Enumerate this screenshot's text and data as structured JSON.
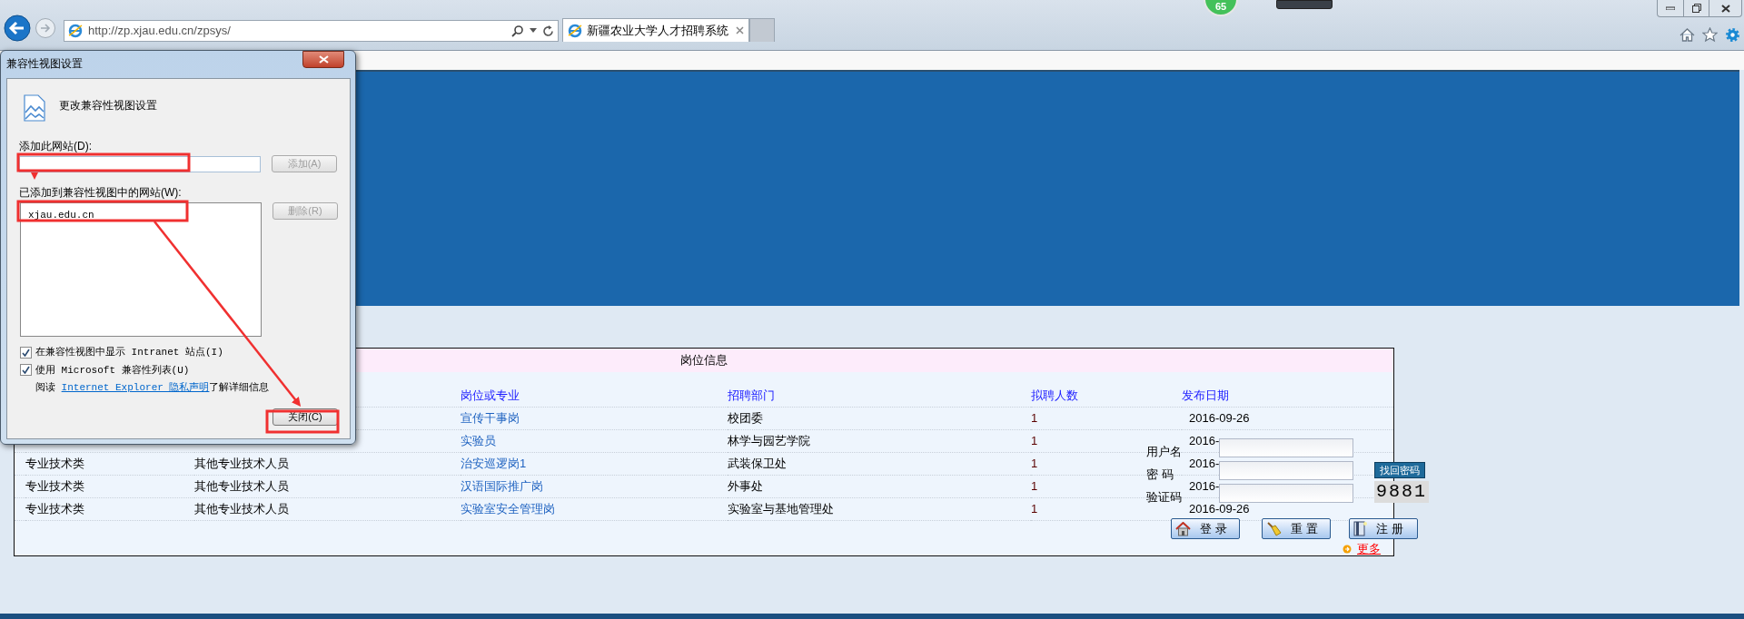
{
  "browser": {
    "address": "http://zp.xjau.edu.cn/zpsys/",
    "tab_title": "新疆农业大学人才招聘系统",
    "badge": "65"
  },
  "dialog": {
    "title": "兼容性视图设置",
    "heading": "更改兼容性视图设置",
    "add_label": "添加此网站(D):",
    "add_button": {
      "label": "添加(A)",
      "disabled": true
    },
    "list_label": "已添加到兼容性视图中的网站(W):",
    "sites": [
      "xjau.edu.cn"
    ],
    "remove_button": {
      "label": "删除(R)",
      "disabled": true
    },
    "options": [
      {
        "label": "在兼容性视图中显示 Intranet 站点(I)",
        "checked": true
      },
      {
        "label": "使用 Microsoft 兼容性列表(U)",
        "checked": true
      }
    ],
    "privacy": {
      "prefix": "阅读",
      "link": "Internet Explorer 隐私声明",
      "suffix": "了解详细信息"
    },
    "close_button": "关闭(C)"
  },
  "table": {
    "title": "岗位信息",
    "columns": [
      "岗位或专业",
      "招聘部门",
      "拟聘人数",
      "发布日期"
    ],
    "rows": [
      {
        "position": "宣传干事岗",
        "department": "校团委",
        "count": "1",
        "date": "2016-09-26"
      },
      {
        "position": "实验员",
        "department": "林学与园艺学院",
        "count": "1",
        "date": "2016-"
      },
      {
        "category": "专业技术类",
        "type": "其他专业技术人员",
        "position": "治安巡逻岗1",
        "department": "武装保卫处",
        "count": "1",
        "date": "2016-"
      },
      {
        "category": "专业技术类",
        "type": "其他专业技术人员",
        "position": "汉语国际推广岗",
        "department": "外事处",
        "count": "1",
        "date": "2016-"
      },
      {
        "category": "专业技术类",
        "type": "其他专业技术人员",
        "position": "实验室安全管理岗",
        "department": "实验室与基地管理处",
        "count": "1",
        "date": "2016-09-26"
      }
    ]
  },
  "login": {
    "fields": [
      {
        "label": "用户名"
      },
      {
        "label": "密 码"
      },
      {
        "label": "验证码"
      }
    ],
    "find_password": "找回密码",
    "captcha": "9881",
    "buttons": [
      {
        "kind": "home",
        "label": "登 录"
      },
      {
        "kind": "broom",
        "label": "重 置"
      },
      {
        "kind": "book",
        "label": "注 册"
      }
    ],
    "more": "更多"
  }
}
